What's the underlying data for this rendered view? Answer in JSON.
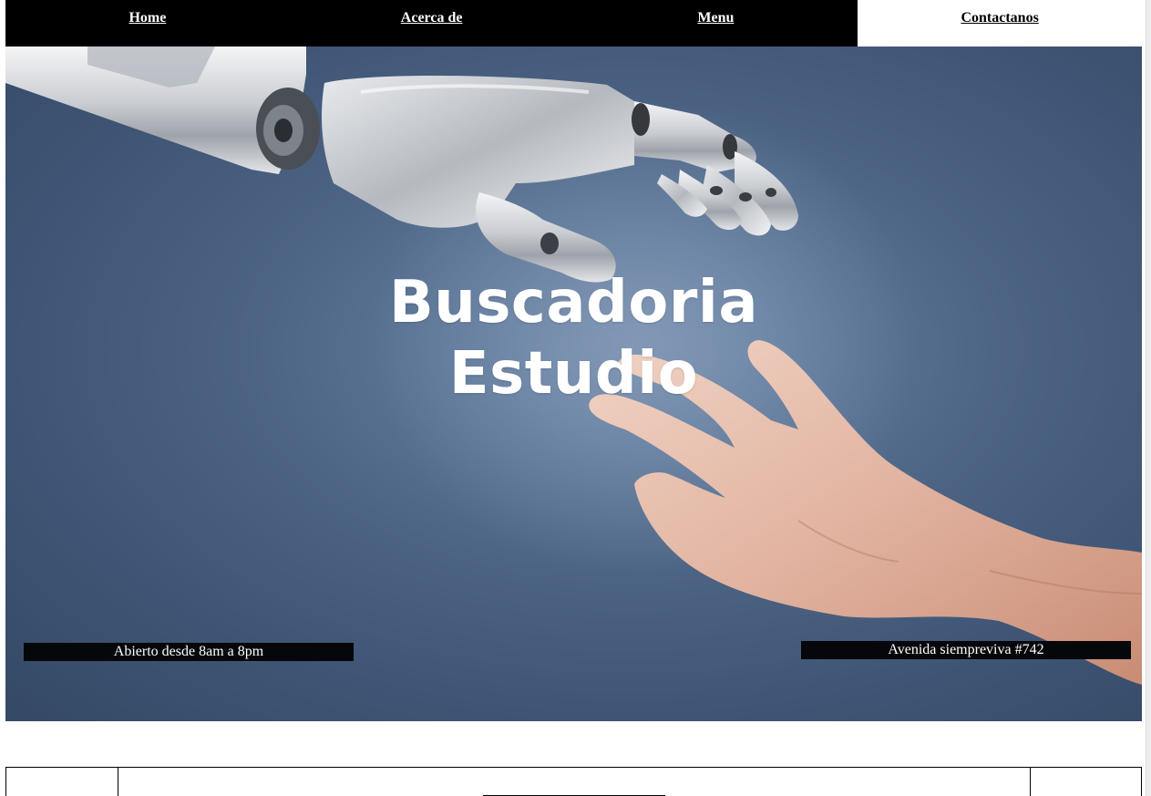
{
  "nav": {
    "items": [
      {
        "label": "Home",
        "active": false
      },
      {
        "label": "Acerca de",
        "active": false
      },
      {
        "label": "Menu",
        "active": false
      },
      {
        "label": "Contactanos",
        "active": true
      }
    ]
  },
  "hero": {
    "title_line1": "Buscadoria",
    "title_line2": "Estudio",
    "hours": "Abierto desde 8am a 8pm",
    "address": "Avenida siempreviva #742",
    "image": "robot-hand-reaching-human-hand"
  },
  "colors": {
    "nav_bg": "#000000",
    "nav_active_bg": "#ffffff",
    "hero_bg": "#4b6282",
    "info_box_bg": "#05070a"
  }
}
